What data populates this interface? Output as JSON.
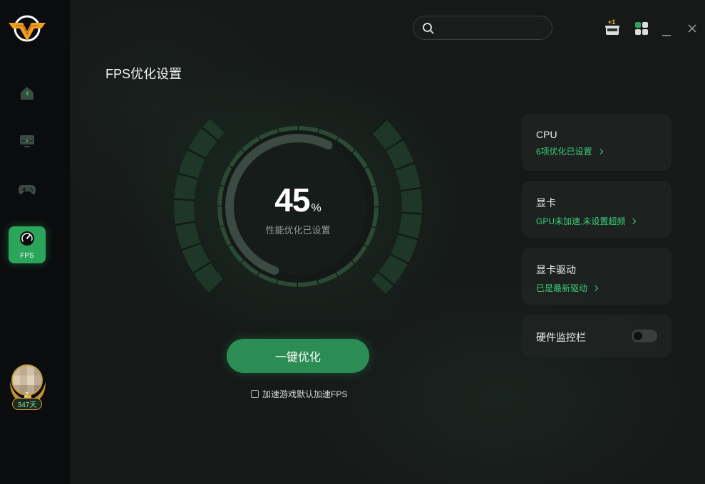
{
  "page": {
    "title": "FPS优化设置"
  },
  "sidebar": {
    "items": [
      {
        "icon": "home-icon",
        "label": ""
      },
      {
        "icon": "monitor-icon",
        "label": ""
      },
      {
        "icon": "gamepad-icon",
        "label": ""
      },
      {
        "icon": "fps-gauge-icon",
        "label": "FPS",
        "active": true
      }
    ],
    "user": {
      "level": "2",
      "days": "347天"
    }
  },
  "search": {
    "placeholder": ""
  },
  "gauge": {
    "value": "45",
    "unit": "%",
    "label": "性能优化已设置",
    "progress": 0.45
  },
  "actions": {
    "optimize_label": "一键优化",
    "auto_fps_label": "加速游戏默认加速FPS",
    "auto_fps_checked": false
  },
  "cards": [
    {
      "title": "CPU",
      "status": "6项优化已设置"
    },
    {
      "title": "显卡",
      "status": "GPU未加速,未设置超频"
    },
    {
      "title": "显卡驱动",
      "status": "已是最新驱动"
    },
    {
      "title": "硬件监控栏",
      "toggle_on": false
    }
  ],
  "colors": {
    "accent": "#2ba55a",
    "status_green": "#3ad07a",
    "sidebar_bg": "#0b0c0e"
  },
  "titlebar": {
    "gift_badge": "+1"
  }
}
